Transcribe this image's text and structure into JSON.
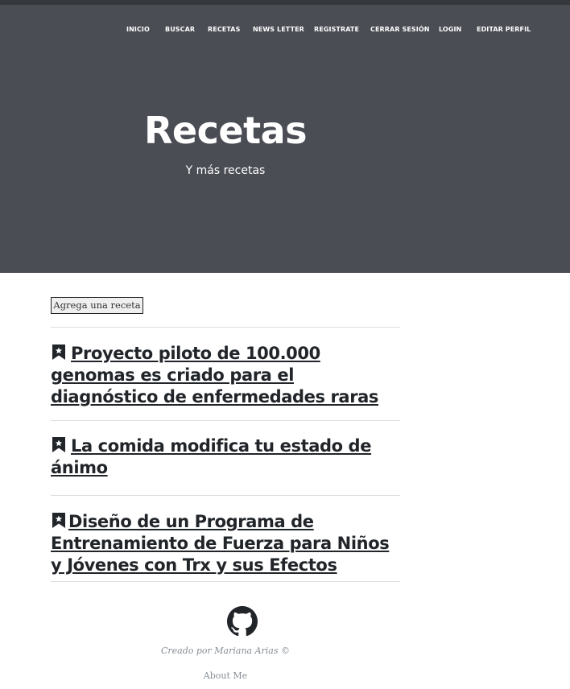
{
  "nav": {
    "items": [
      "INICIO",
      "BUSCAR",
      "RECETAS",
      "NEWS LETTER",
      "REGISTRATE",
      "CERRAR SESIÓN",
      "LOGIN",
      "EDITAR PERFIL"
    ]
  },
  "hero": {
    "title": "Recetas",
    "subtitle": "Y más recetas"
  },
  "actions": {
    "add_recipe_label": "Agrega una receta"
  },
  "posts": [
    {
      "title": "Proyecto piloto de 100.000 genomas es criado para el diagnóstico de enfermedades raras",
      "icon": "bookmark-icon"
    },
    {
      "title": "La comida modifica tu estado de ánimo",
      "icon": "bookmark-icon"
    },
    {
      "title": "Diseño de un Programa de Entrenamiento de Fuerza para Niños y Jóvenes con Trx y sus Efectos",
      "icon": "bookmark-icon"
    }
  ],
  "footer": {
    "github_icon": "github-icon",
    "credit": "Creado por Mariana Arias ©",
    "about_label": "About Me"
  },
  "colors": {
    "hero_bg": "#4a4d54",
    "text_dark": "#212529",
    "muted": "#868e96"
  }
}
